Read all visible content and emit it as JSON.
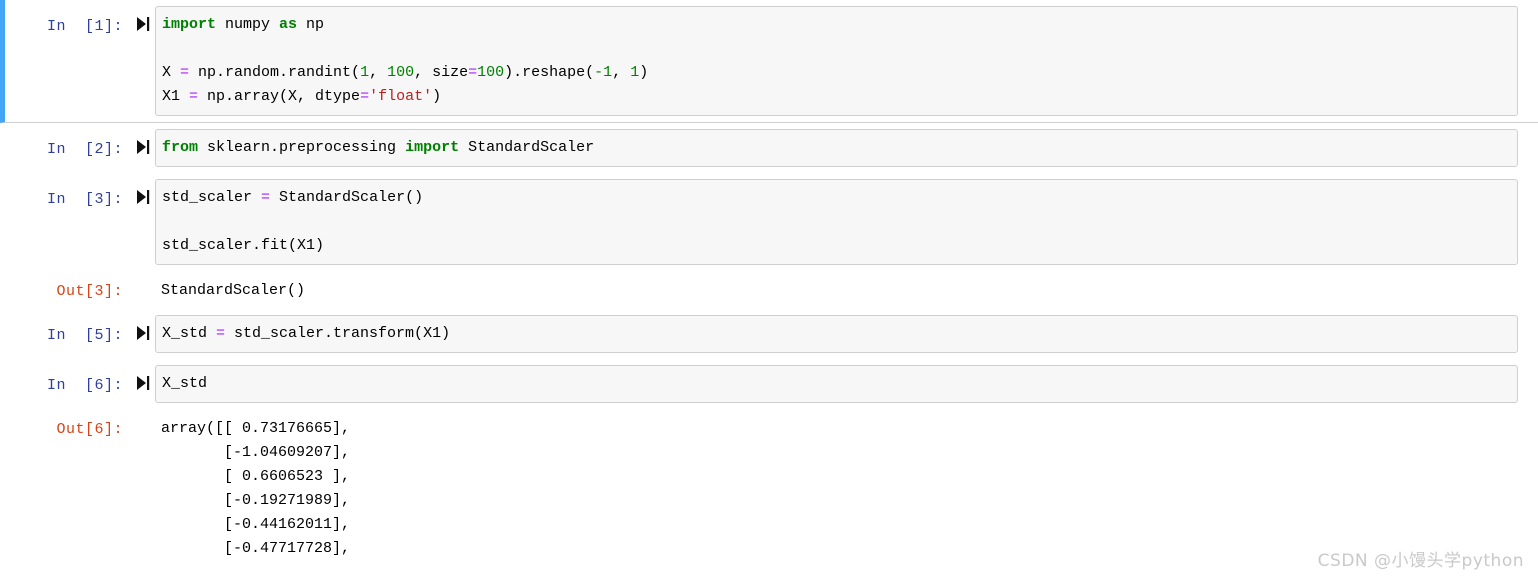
{
  "app": {
    "kind": "jupyter-notebook",
    "selection_bar_color": "#42a5f5",
    "in_prompt_color": "#303F9F",
    "out_prompt_color": "#D84315",
    "input_bg_color": "#f7f7f7",
    "input_border_color": "#cfcfcf"
  },
  "icons": {
    "run_cell": "run-cell-icon"
  },
  "cells": [
    {
      "prompt": "In  [1]:",
      "selected": true,
      "lines": [
        [
          {
            "t": "import",
            "c": "kw"
          },
          {
            "t": " numpy ",
            "c": "pl"
          },
          {
            "t": "as",
            "c": "kw"
          },
          {
            "t": " np",
            "c": "pl"
          }
        ],
        [],
        [
          {
            "t": "X ",
            "c": "pl"
          },
          {
            "t": "=",
            "c": "op"
          },
          {
            "t": " np.random.randint(",
            "c": "pl"
          },
          {
            "t": "1",
            "c": "num"
          },
          {
            "t": ", ",
            "c": "pl"
          },
          {
            "t": "100",
            "c": "num"
          },
          {
            "t": ", size",
            "c": "pl"
          },
          {
            "t": "=",
            "c": "op"
          },
          {
            "t": "100",
            "c": "num"
          },
          {
            "t": ").reshape(",
            "c": "pl"
          },
          {
            "t": "-1",
            "c": "num"
          },
          {
            "t": ", ",
            "c": "pl"
          },
          {
            "t": "1",
            "c": "num"
          },
          {
            "t": ")",
            "c": "pl"
          }
        ],
        [
          {
            "t": "X1 ",
            "c": "pl"
          },
          {
            "t": "=",
            "c": "op"
          },
          {
            "t": " np.array(X, dtype",
            "c": "pl"
          },
          {
            "t": "=",
            "c": "op"
          },
          {
            "t": "'float'",
            "c": "str"
          },
          {
            "t": ")",
            "c": "pl"
          }
        ]
      ],
      "output": null
    },
    {
      "prompt": "In  [2]:",
      "selected": false,
      "lines": [
        [
          {
            "t": "from",
            "c": "kw"
          },
          {
            "t": " sklearn.preprocessing ",
            "c": "pl"
          },
          {
            "t": "import",
            "c": "kw"
          },
          {
            "t": " StandardScaler",
            "c": "pl"
          }
        ]
      ],
      "output": null
    },
    {
      "prompt": "In  [3]:",
      "selected": false,
      "lines": [
        [
          {
            "t": "std_scaler ",
            "c": "pl"
          },
          {
            "t": "=",
            "c": "op"
          },
          {
            "t": " StandardScaler()",
            "c": "pl"
          }
        ],
        [],
        [
          {
            "t": "std_scaler.fit(X1)",
            "c": "pl"
          }
        ]
      ],
      "output": {
        "prompt": "Out[3]:",
        "text": "StandardScaler()"
      }
    },
    {
      "prompt": "In  [5]:",
      "selected": false,
      "lines": [
        [
          {
            "t": "X_std ",
            "c": "pl"
          },
          {
            "t": "=",
            "c": "op"
          },
          {
            "t": " std_scaler.transform(X1)",
            "c": "pl"
          }
        ]
      ],
      "output": null
    },
    {
      "prompt": "In  [6]:",
      "selected": false,
      "lines": [
        [
          {
            "t": "X_std",
            "c": "pl"
          }
        ]
      ],
      "output": {
        "prompt": "Out[6]:",
        "text": "array([[ 0.73176665],\n       [-1.04609207],\n       [ 0.6606523 ],\n       [-0.19271989],\n       [-0.44162011],\n       [-0.47717728],"
      }
    }
  ],
  "watermark": {
    "text": "CSDN @小馒头学python"
  }
}
